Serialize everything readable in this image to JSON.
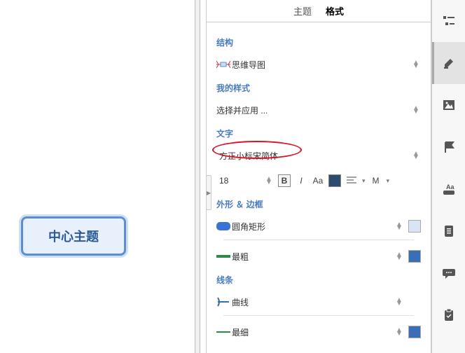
{
  "canvas": {
    "center_topic": "中心主题"
  },
  "panel": {
    "tabs": {
      "theme": "主题",
      "format": "格式"
    },
    "sections": {
      "structure": "结构",
      "my_styles": "我的样式",
      "text": "文字",
      "shape_border": "外形 ＆ 边框",
      "line": "线条"
    },
    "structure_value": "思维导图",
    "my_styles_value": "选择并应用 ...",
    "font_name": "方正小标宋简体",
    "font_size": "18",
    "m_label": "M",
    "shape_value": "圆角矩形",
    "border_weight": "最粗",
    "line_type": "曲线",
    "line_weight": "最细",
    "text_color": "#2d4a6f",
    "shape_fill": "#d9e4f5",
    "border_color": "#3a6fb8",
    "line_color": "#3a6fb8"
  }
}
